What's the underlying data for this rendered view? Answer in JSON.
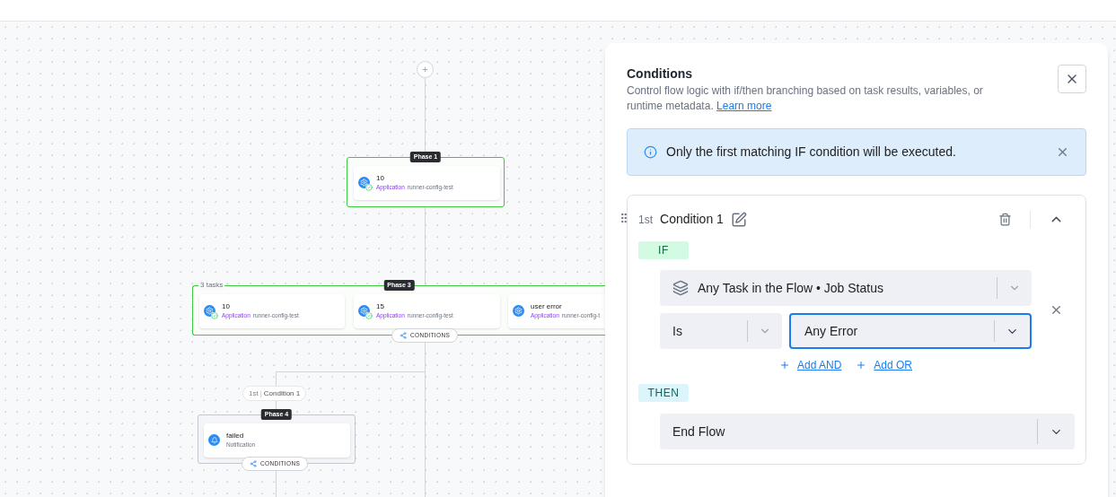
{
  "canvas": {
    "add_button": "+",
    "phases": [
      {
        "label": "Phase 1",
        "highlighted": true,
        "tasks": [
          {
            "kind": "application",
            "name": "10",
            "type": "Application",
            "detail": "runner-config-test",
            "succeeded": true
          }
        ]
      },
      {
        "label": "Phase 3",
        "highlighted": true,
        "count": "3 tasks",
        "conditions": "CONDITIONS",
        "tasks": [
          {
            "kind": "application",
            "name": "10",
            "type": "Application",
            "detail": "runner-config-test",
            "succeeded": true
          },
          {
            "kind": "application",
            "name": "15",
            "type": "Application",
            "detail": "runner-config-test",
            "succeeded": true
          },
          {
            "kind": "application",
            "name": "user error",
            "type": "Application",
            "detail": "runner-config-t",
            "succeeded": false
          }
        ]
      },
      {
        "label": "Phase 4",
        "highlighted": false,
        "conditions": "CONDITIONS",
        "tasks": [
          {
            "kind": "notification",
            "name": "failed",
            "type": "Notification",
            "succeeded": false
          }
        ]
      }
    ],
    "branch_label": {
      "rank": "1st",
      "separator": "|",
      "name": "Condition 1"
    }
  },
  "panel": {
    "title": "Conditions",
    "description": "Control flow logic with if/then branching based on task results, variables, or runtime metadata.",
    "link": "Learn more",
    "banner": "Only the first matching IF condition will be executed.",
    "conditions": [
      {
        "rank": "1st",
        "name": "Condition 1",
        "expanded": true,
        "if_label": "IF",
        "clause": {
          "source": "Any Task in the Flow • Job Status",
          "operator": "Is",
          "value": "Any Error",
          "value_focused": true
        },
        "add_links": [
          "Add AND",
          "Add OR"
        ],
        "then_label": "THEN",
        "action": "End Flow"
      }
    ]
  }
}
